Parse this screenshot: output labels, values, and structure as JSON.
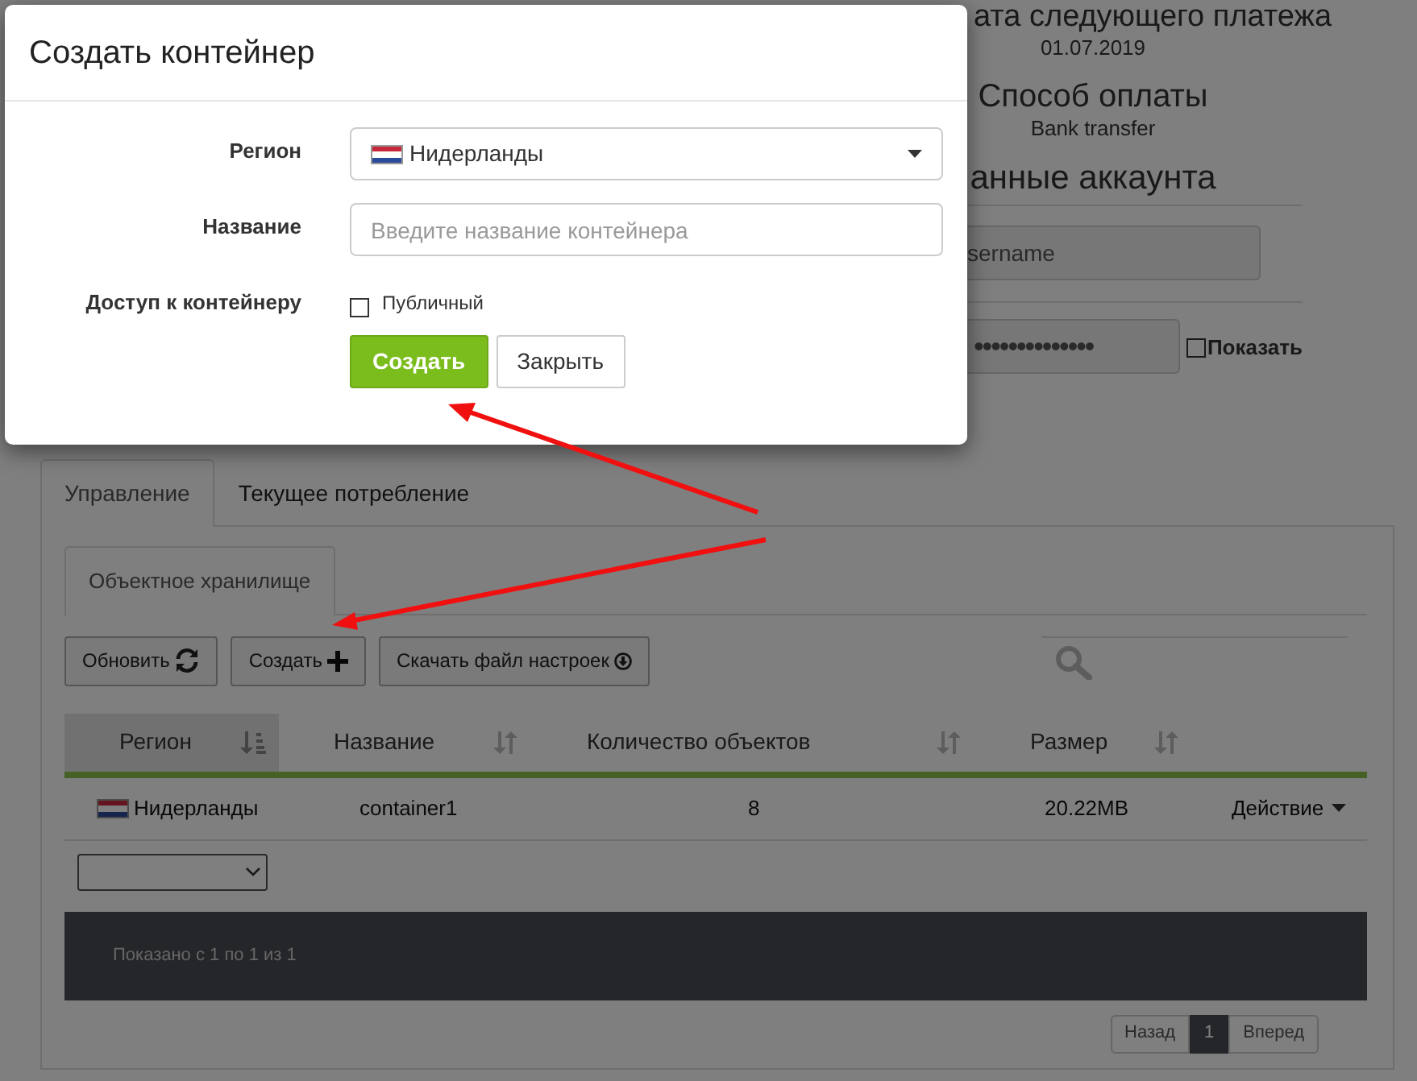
{
  "account_panel": {
    "payment_heading": "ата следующего платежа",
    "payment_date": "01.07.2019",
    "method_heading": "Способ оплаты",
    "method_value": "Bank transfer",
    "account_heading": "анные аккаунта",
    "username_value": "sername",
    "password_value": "••••••••••••••",
    "show_password": {
      "label": "Показать",
      "checked": false
    }
  },
  "tabs": [
    {
      "label": "Управление",
      "selected": true
    },
    {
      "label": "Текущее потребление",
      "selected": false
    }
  ],
  "subtabs": [
    {
      "label": "Объектное хранилище",
      "selected": true
    }
  ],
  "toolbar": [
    {
      "label": "Обновить",
      "kind": "refresh"
    },
    {
      "label": "Создать",
      "kind": "plus"
    },
    {
      "label": "Скачать файл настроек",
      "kind": "download"
    }
  ],
  "table": {
    "columns": [
      {
        "label": "Регион",
        "selected": true
      },
      {
        "label": "Название",
        "selected": false
      },
      {
        "label": "Количество объектов",
        "selected": false
      },
      {
        "label": "Размер",
        "selected": false
      }
    ],
    "rows": [
      {
        "region": "Нидерланды",
        "name": "container1",
        "count": "8",
        "size": "20.22MB",
        "action": "Действие"
      }
    ]
  },
  "footer": {
    "info": "Показано с 1 по 1 из 1"
  },
  "pagination": {
    "prev": "Назад",
    "pages": [
      {
        "label": "1",
        "selected": true
      }
    ],
    "next": "Вперед"
  },
  "modal": {
    "title": "Создать контейнер",
    "fields": [
      {
        "kind": "select",
        "label": "Регион",
        "value": "Нидерланды"
      },
      {
        "kind": "text",
        "label": "Название",
        "placeholder": "Введите название контейнера"
      },
      {
        "kind": "checkbox",
        "label": "Доступ к контейнеру",
        "option": "Публичный",
        "checked": false
      }
    ],
    "buttons": [
      {
        "label": "Создать",
        "kind": "primary"
      },
      {
        "label": "Закрыть",
        "kind": "default"
      }
    ]
  }
}
